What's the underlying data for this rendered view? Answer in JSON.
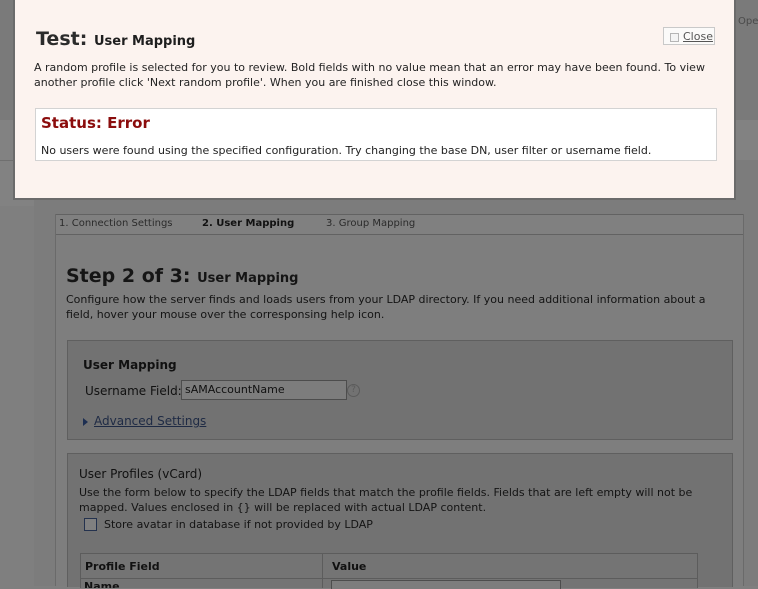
{
  "background": {
    "top_right_text": "Ope",
    "steps": [
      {
        "label": "1. Connection Settings",
        "active": false
      },
      {
        "label": "2. User Mapping",
        "active": true
      },
      {
        "label": "3. Group Mapping",
        "active": false
      }
    ],
    "heading_prefix": "Step 2 of 3:",
    "heading_suffix": "User Mapping",
    "description": "Configure how the server finds and loads users from your LDAP directory. If you need additional information about a field, hover your mouse over the corresponsing help icon.",
    "user_mapping": {
      "title": "User Mapping",
      "username_label": "Username Field:",
      "username_value": "sAMAccountName",
      "help_icon": "question-mark-icon",
      "advanced_link": "Advanced Settings"
    },
    "user_profiles": {
      "title": "User Profiles (vCard)",
      "description": "Use the form below to specify the LDAP fields that match the profile fields. Fields that are left empty will not be mapped. Values enclosed in {} will be replaced with actual LDAP content.",
      "store_avatar_label": "Store avatar in database if not provided by LDAP",
      "store_avatar_checked": false,
      "table_headers": [
        "Profile Field",
        "Value"
      ],
      "first_row_label": "Name"
    }
  },
  "modal": {
    "title_prefix": "Test:",
    "title_suffix": "User Mapping",
    "close_label": "Close",
    "description": "A random profile is selected for you to review. Bold fields with no value mean that an error may have been found. To view another profile click 'Next random profile'. When you are finished close this window.",
    "status_title": "Status: Error",
    "status_message": "No users were found using the specified configuration. Try changing the base DN, user filter or username field.",
    "colors": {
      "background": "#fcf3ef",
      "error": "#8b0d0d"
    }
  }
}
